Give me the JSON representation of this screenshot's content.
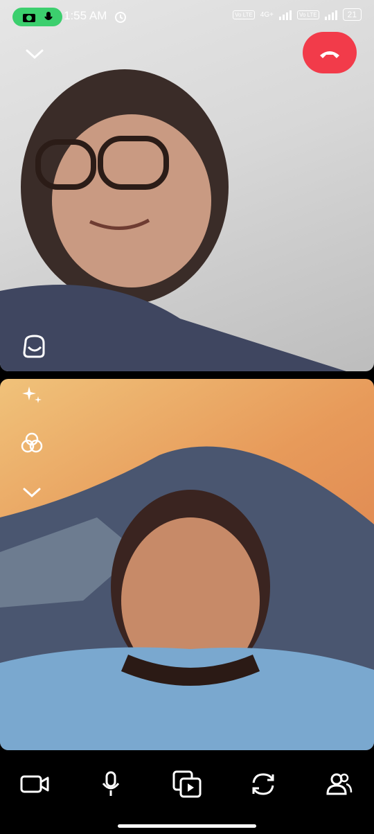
{
  "status_bar": {
    "time": "1:55 AM",
    "network_label": "4G+",
    "volte_label_1": "Vo LTE",
    "volte_label_2": "Vo LTE",
    "battery": "21"
  },
  "remote_video": {
    "icon": "chevron-down-icon"
  },
  "local_video": {
    "icons": [
      "sparkles-icon",
      "filters-icon",
      "chevron-down-icon"
    ]
  },
  "toolbar": {
    "items": [
      "camera-icon",
      "microphone-icon",
      "share-screen-icon",
      "flip-camera-icon",
      "participants-icon"
    ]
  },
  "colors": {
    "end_call": "#f23b4a",
    "recording_pill": "#3ccf6e"
  }
}
